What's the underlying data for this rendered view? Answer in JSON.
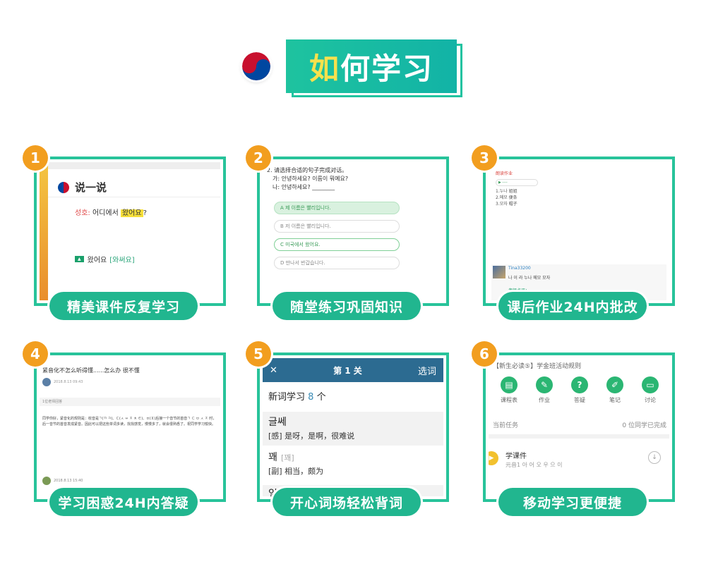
{
  "banner": {
    "title_first": "如",
    "title_rest": "何学习"
  },
  "colors": {
    "teal": "#21c3a0",
    "orange": "#f29e1f",
    "caption": "#21b68f",
    "highlight": "#f7e14d"
  },
  "cards": [
    {
      "num": "1",
      "caption": "精美课件反复学习",
      "title": "说一说",
      "speaker": "성호:",
      "line": "어디에서",
      "marked": "왔어요",
      "line_end": "?",
      "tag": "▲",
      "answer": "왔어요",
      "roman": "[와써요]"
    },
    {
      "num": "2",
      "caption": "随堂练习巩固知识",
      "question": "2. 请选择合适的句子完成对话。",
      "q_a": "가: 안녕하세요? 이름이 뭐예요?",
      "q_b": "나: 안녕하세요? ________",
      "options": [
        "A 제 이름은 빨리입니다.",
        "B 저 이름은 빨리입니다.",
        "C 미국에서 왔어요.",
        "D 만나서 반갑습니다."
      ]
    },
    {
      "num": "3",
      "caption": "课后作业24H内批改",
      "hw_title": "朗读作业",
      "items": [
        "1.누나 姐姐",
        "2.메모 便条",
        "3.모자 帽子"
      ],
      "user": "Tina33200",
      "user_text": "나 이 라 누나 메모 모자",
      "teacher": "老师点评："
    },
    {
      "num": "4",
      "caption": "学习困惑24H内答疑",
      "title": "紧音化不怎么听得懂......怎么办 很不懂",
      "meta": "2018.8.13 09:43",
      "bar": "1位老师回答",
      "text": "同学你好，紧音化的规则是：收音是ㄱ(ㄲ ㅋ)、ㄷ(ㅅ ㅆ ㅈ ㅊ ㅌ)、ㅂ(ㅍ)后接一个音节的首音ㄱ ㄷ ㅂ ㅅ ㅈ 时，后一音节的首音发成紧音。因此可以把这些单词多读，找找感觉，慢慢多了，就会很熟悉了。祝同学学习愉快。",
      "foot": "2018.8.13 15:40"
    },
    {
      "num": "5",
      "caption": "开心词场轻松背词",
      "top_mid": "第 1 关",
      "top_right": "选词",
      "sub_label": "新词学习",
      "sub_num": "8",
      "sub_unit": "个",
      "words": [
        {
          "w": "글쎄",
          "r": "",
          "m": "[感] 是呀，是啊，很难说"
        },
        {
          "w": "꽤",
          "r": "[꽤]",
          "m": "[副] 相当，颇为"
        },
        {
          "w": "일일이",
          "r": "",
          "m": ""
        }
      ]
    },
    {
      "num": "6",
      "caption": "移动学习更便捷",
      "top": "【新生必读⑤】学金班活动规则",
      "icons": [
        "课程表",
        "作业",
        "答疑",
        "笔记",
        "讨论"
      ],
      "task_label": "当前任务",
      "task_right": "0 位同学已完成",
      "lesson": "学课件",
      "lesson_sub": "元音1 아 어 오 우 으 이"
    }
  ]
}
